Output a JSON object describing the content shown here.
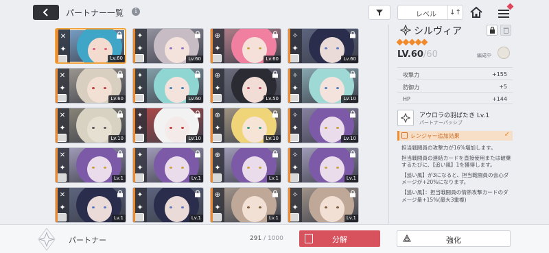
{
  "header": {
    "title": "パートナー一覧",
    "info_icon": "info-icon",
    "sort_label": "レベル",
    "sort_order_icon": "sort-order-icon"
  },
  "partners": [
    {
      "level": "Lv.60",
      "hair": "#3fa6c8",
      "skin": "#f3dbcf",
      "eye": "#e05a7a",
      "bg": "#7ca7cf",
      "selected": true
    },
    {
      "level": "Lv.60",
      "hair": "#c8bcc4",
      "skin": "#f4e2dc",
      "eye": "#8e6ec8",
      "bg": "#9b9aa6"
    },
    {
      "level": "Lv.60",
      "hair": "#f07fa0",
      "skin": "#f6e0da",
      "eye": "#c8a53a",
      "bg": "#b9828e"
    },
    {
      "level": "Lv.60",
      "hair": "#2a2d4c",
      "skin": "#eadbd8",
      "eye": "#5a78c8",
      "bg": "#5f6782"
    },
    {
      "level": "Lv.60",
      "hair": "#d8cfc0",
      "skin": "#f3e0d4",
      "eye": "#c23b3b",
      "bg": "#a49e96"
    },
    {
      "level": "Lv.60",
      "hair": "#8fd6d2",
      "skin": "#f4e2dc",
      "eye": "#3a7fb4",
      "bg": "#8aa8b0"
    },
    {
      "level": "Lv.50",
      "hair": "#2b2b34",
      "skin": "#f1dcd6",
      "eye": "#c0455e",
      "bg": "#707080"
    },
    {
      "level": "Lv.10",
      "hair": "#9fd9d6",
      "skin": "#f4e2dc",
      "eye": "#4a7fc0",
      "bg": "#8eb0b8"
    },
    {
      "level": "Lv.10",
      "hair": "#d8d2c2",
      "skin": "#e6e0d2",
      "eye": "#5a5a5a",
      "bg": "#8f8a7c"
    },
    {
      "level": "Lv.10",
      "hair": "#f2f2f2",
      "skin": "#f5eaea",
      "eye": "#c43b3b",
      "bg": "#b34848"
    },
    {
      "level": "Lv.10",
      "hair": "#f0d478",
      "skin": "#f6e4d6",
      "eye": "#3a9a8a",
      "bg": "#a89a86"
    },
    {
      "level": "Lv.10",
      "hair": "#7c5aa8",
      "skin": "#eadcea",
      "eye": "#c8a03a",
      "bg": "#8e86a8"
    },
    {
      "level": "Lv.1",
      "hair": "#7c5aa8",
      "skin": "#eadcea",
      "eye": "#c8a03a",
      "bg": "#a8a2c0"
    },
    {
      "level": "Lv.1",
      "hair": "#7c5aa8",
      "skin": "#eadcea",
      "eye": "#c8a03a",
      "bg": "#a8a2c0"
    },
    {
      "level": "Lv.1",
      "hair": "#7c5aa8",
      "skin": "#eadcea",
      "eye": "#c8a03a",
      "bg": "#a8a2c0"
    },
    {
      "level": "Lv.1",
      "hair": "#7c5aa8",
      "skin": "#eadcea",
      "eye": "#c8a03a",
      "bg": "#a8a2c0"
    },
    {
      "level": "Lv.1",
      "hair": "#2a2d4c",
      "skin": "#eadbd8",
      "eye": "#5a78c8",
      "bg": "#5f6782"
    },
    {
      "level": "Lv.1",
      "hair": "#2a2d4c",
      "skin": "#eadbd8",
      "eye": "#5a78c8",
      "bg": "#5f6782"
    },
    {
      "level": "Lv.1",
      "hair": "#bfa898",
      "skin": "#f3e0d4",
      "eye": "#7a5a3a",
      "bg": "#a89a8e"
    },
    {
      "level": "Lv.1",
      "hair": "#bfa898",
      "skin": "#f3e0d4",
      "eye": "#7a5a3a",
      "bg": "#a89a8e"
    }
  ],
  "detail": {
    "name": "シルヴィア",
    "rarity_stars": 5,
    "level": "LV.60",
    "level_max": "/60",
    "team_label": "編成中",
    "stats": [
      {
        "label": "攻撃力",
        "value": "+155"
      },
      {
        "label": "防御力",
        "value": "+5"
      },
      {
        "label": "HP",
        "value": "+144"
      }
    ],
    "skill": {
      "name": "アウロラの羽ばたき Lv.1",
      "type": "パートナーパッシブ"
    },
    "bonus_label": "レンジャー追加効果",
    "description": [
      "担当戦闘員の攻撃力が16%増加します。",
      "担当戦闘員の連結カードを直接使用または破棄するたびに、【追い風】1を獲得します。",
      "【追い風】が3になると、担当戦闘員の会心ダメージが+20%になります。",
      "【追い風】：担当戦闘員の情熱攻撃カードのダメージ量+15%(最大3重複)"
    ]
  },
  "bottom": {
    "section_label": "パートナー",
    "count": "291",
    "count_max": "/ 1000",
    "dismantle_label": "分解",
    "enhance_label": "強化"
  },
  "colors": {
    "accent": "#f08a2a",
    "dismantle": "#d8525e",
    "selected_border": "#f0a23c"
  }
}
